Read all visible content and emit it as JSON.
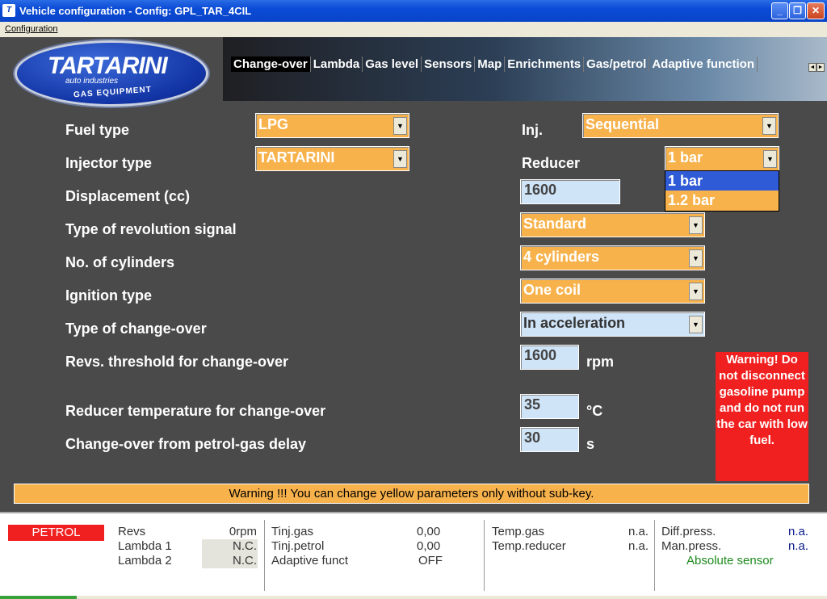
{
  "window": {
    "title": "Vehicle configuration - Config: GPL_TAR_4CIL",
    "minimize": "_",
    "restore": "❐",
    "close": "✕"
  },
  "menu": {
    "configuration": "Configuration"
  },
  "logo": {
    "line1": "TARTARINI",
    "line2": "auto industries",
    "line3": "GAS EQUIPMENT"
  },
  "tabs": [
    "Change-over",
    "Lambda",
    "Gas level",
    "Sensors",
    "Map",
    "Enrichments",
    "Gas/petrol",
    "Adaptive function"
  ],
  "tab_arrows": [
    "◄",
    "►"
  ],
  "form": {
    "fuel_type": {
      "label": "Fuel type",
      "value": "LPG"
    },
    "injector_type": {
      "label": "Injector type",
      "value": "TARTARINI"
    },
    "displacement": {
      "label": "Displacement (cc)",
      "value": "1600"
    },
    "revolution_signal": {
      "label": "Type of revolution signal",
      "value": "Standard"
    },
    "cylinders": {
      "label": "No. of cylinders",
      "value": "4 cylinders"
    },
    "ignition": {
      "label": "Ignition type",
      "value": "One coil"
    },
    "changeover_type": {
      "label": "Type of change-over",
      "value": "In acceleration"
    },
    "revs_threshold": {
      "label": "Revs. threshold for change-over",
      "value": "1600",
      "unit": "rpm"
    },
    "reducer_temp": {
      "label": "Reducer temperature for change-over",
      "value": "35",
      "unit": "°C"
    },
    "petrol_gas_delay": {
      "label": "Change-over from petrol-gas delay",
      "value": "30",
      "unit": "s"
    },
    "inj": {
      "label": "Inj.",
      "value": "Sequential"
    },
    "reducer": {
      "label": "Reducer",
      "value": "1 bar",
      "options": [
        "1 bar",
        "1.2 bar"
      ]
    }
  },
  "arrow_glyph": "▼",
  "warning_box": "Warning! Do not disconnect gasoline pump and do not run the car with low fuel.",
  "warning_bar": "Warning !!! You can change yellow parameters only without sub-key.",
  "status": {
    "mode": "PETROL",
    "revs_label": "Revs",
    "revs_value": "0rpm",
    "lambda1_label": "Lambda 1",
    "lambda1_value": "N.C.",
    "lambda2_label": "Lambda 2",
    "lambda2_value": "N.C.",
    "tinj_gas_label": "Tinj.gas",
    "tinj_gas_value": "0,00",
    "tinj_petrol_label": "Tinj.petrol",
    "tinj_petrol_value": "0,00",
    "adaptive_label": "Adaptive funct",
    "adaptive_value": "OFF",
    "temp_gas_label": "Temp.gas",
    "temp_gas_value": "n.a.",
    "temp_reducer_label": "Temp.reducer",
    "temp_reducer_value": "n.a.",
    "diff_press_label": "Diff.press.",
    "diff_press_value": "n.a.",
    "man_press_label": "Man.press.",
    "man_press_value": "n.a.",
    "sensor": "Absolute sensor"
  },
  "colors": {
    "orange": "#f7b24c",
    "red": "#f02020",
    "navy": "#0a1a8a",
    "green": "#1a8a1a"
  }
}
